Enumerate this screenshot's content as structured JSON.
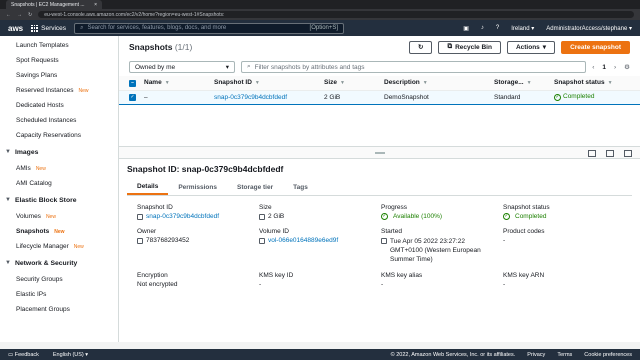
{
  "browser": {
    "tab_title": "Snapshots | EC2 Management ...",
    "url": "eu-west-1.console.aws.amazon.com/ec2/v2/home?region=eu-west-1#Snapshots:"
  },
  "nav": {
    "logo": "aws",
    "services": "Services",
    "search_placeholder": "Search for services, features, blogs, docs, and more",
    "search_shortcut": "[Option+S]",
    "region": "Ireland",
    "account": "AdministratorAccess/stephane"
  },
  "sidebar": {
    "items_top": [
      {
        "label": "Launch Templates",
        "new": ""
      },
      {
        "label": "Spot Requests",
        "new": ""
      },
      {
        "label": "Savings Plans",
        "new": ""
      },
      {
        "label": "Reserved Instances",
        "new": "New"
      },
      {
        "label": "Dedicated Hosts",
        "new": ""
      },
      {
        "label": "Scheduled Instances",
        "new": ""
      },
      {
        "label": "Capacity Reservations",
        "new": ""
      }
    ],
    "images_title": "Images",
    "images_items": [
      {
        "label": "AMIs",
        "new": "New"
      },
      {
        "label": "AMI Catalog",
        "new": ""
      }
    ],
    "ebs_title": "Elastic Block Store",
    "ebs_items": [
      {
        "label": "Volumes",
        "new": "New"
      },
      {
        "label": "Snapshots",
        "new": "New"
      },
      {
        "label": "Lifecycle Manager",
        "new": "New"
      }
    ],
    "net_title": "Network & Security",
    "net_items": [
      {
        "label": "Security Groups",
        "new": ""
      },
      {
        "label": "Elastic IPs",
        "new": ""
      },
      {
        "label": "Placement Groups",
        "new": ""
      }
    ]
  },
  "header": {
    "title": "Snapshots",
    "count": "(1/1)",
    "recycle_bin": "Recycle Bin",
    "actions": "Actions",
    "create": "Create snapshot"
  },
  "filters": {
    "owned_by": "Owned by me",
    "placeholder": "Filter snapshots by attributes and tags",
    "page": "1"
  },
  "table": {
    "columns": [
      "Name",
      "Snapshot ID",
      "Size",
      "Description",
      "Storage...",
      "Snapshot status"
    ],
    "row": {
      "name": "–",
      "id": "snap-0c379c9b4dcbfdedf",
      "size": "2 GiB",
      "description": "DemoSnapshot",
      "storage": "Standard",
      "status": "Completed"
    }
  },
  "detail": {
    "title": "Snapshot ID: snap-0c379c9b4dcbfdedf",
    "tabs": [
      "Details",
      "Permissions",
      "Storage tier",
      "Tags"
    ],
    "fields": {
      "snapshot_id_label": "Snapshot ID",
      "snapshot_id": "snap-0c379c9b4dcbfdedf",
      "size_label": "Size",
      "size": "2 GiB",
      "progress_label": "Progress",
      "progress": "Available (100%)",
      "status_label": "Snapshot status",
      "status": "Completed",
      "owner_label": "Owner",
      "owner": "783768293452",
      "volume_label": "Volume ID",
      "volume": "vol-066e0164889e6ed9f",
      "started_label": "Started",
      "started": "Tue Apr 05 2022 23:27:22 GMT+0100 (Western European Summer Time)",
      "product_label": "Product codes",
      "product": "-",
      "encryption_label": "Encryption",
      "encryption": "Not encrypted",
      "kms_id_label": "KMS key ID",
      "kms_id": "-",
      "kms_alias_label": "KMS key alias",
      "kms_alias": "-",
      "kms_arn_label": "KMS key ARN",
      "kms_arn": "-"
    }
  },
  "footer": {
    "feedback": "Feedback",
    "language": "English (US)",
    "copyright": "© 2022, Amazon Web Services, Inc. or its affiliates.",
    "privacy": "Privacy",
    "terms": "Terms",
    "cookie": "Cookie preferences"
  },
  "colors": {
    "nav": "#232f3e",
    "accent": "#ec7211",
    "link": "#0073bb",
    "success": "#1d8102"
  }
}
